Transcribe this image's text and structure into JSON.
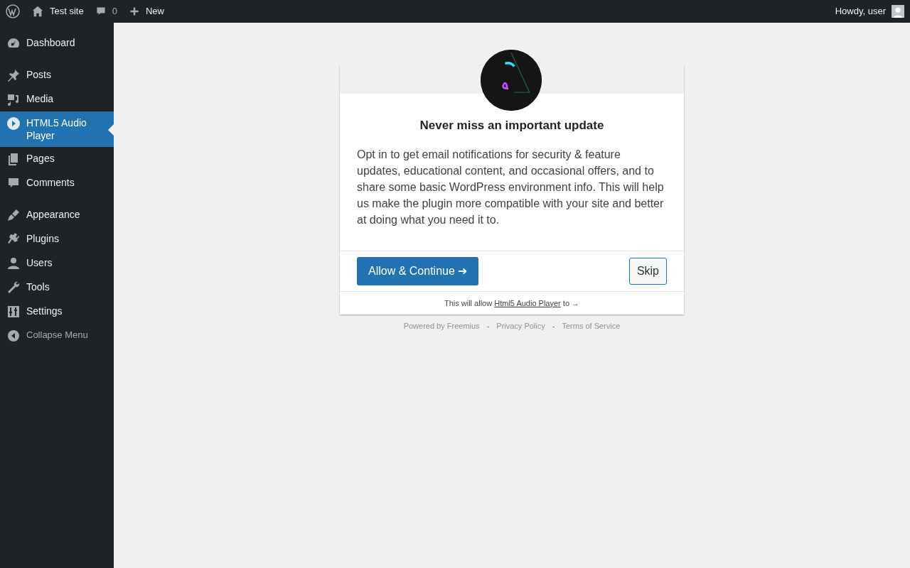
{
  "admin_bar": {
    "site": "Test site",
    "comments": "0",
    "new": "New",
    "greeting": "Howdy, user"
  },
  "sidebar": {
    "groups": [
      [
        {
          "label": "Dashboard",
          "selected": false
        }
      ],
      [
        {
          "label": "Posts",
          "selected": false
        },
        {
          "label": "Media",
          "selected": false
        },
        {
          "label": "HTML5 Audio Player",
          "selected": true
        },
        {
          "label": "Pages",
          "selected": false
        },
        {
          "label": "Comments",
          "selected": false
        }
      ],
      [
        {
          "label": "Appearance",
          "selected": false
        },
        {
          "label": "Plugins",
          "selected": false
        },
        {
          "label": "Users",
          "selected": false
        },
        {
          "label": "Tools",
          "selected": false
        },
        {
          "label": "Settings",
          "selected": false
        }
      ]
    ],
    "collapse": "Collapse Menu"
  },
  "dialog": {
    "title": "Never miss an important update",
    "body": "Opt in to get email notifications for security & feature updates, educational content, and occasional offers, and to share some basic WordPress environment info. This will help us make the plugin more compatible with your site and better at doing what you need it to.",
    "primary_button": "Allow & Continue ➜",
    "secondary_button": "Skip",
    "permissions": {
      "before": "This will allow ",
      "link": "Html5 Audio Player",
      "after": " to →"
    }
  },
  "footer": [
    {
      "kind": "link",
      "text": "Powered by Freemius"
    },
    {
      "kind": "separator",
      "text": "-"
    },
    {
      "kind": "link",
      "text": "Privacy Policy"
    },
    {
      "kind": "separator",
      "text": "-"
    },
    {
      "kind": "link",
      "text": "Terms of Service"
    }
  ]
}
